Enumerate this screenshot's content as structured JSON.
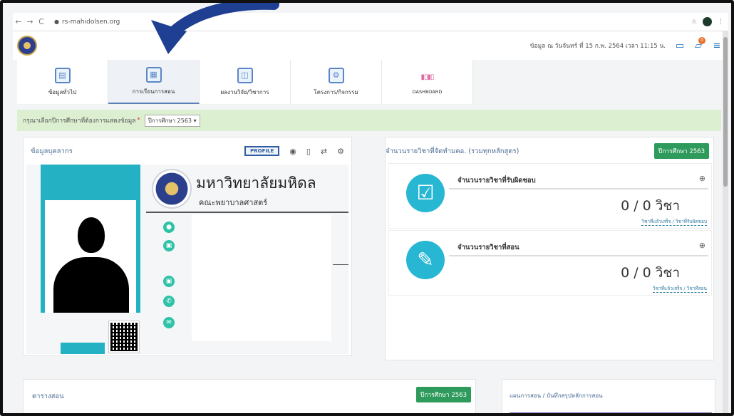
{
  "browser": {
    "url": "rs-mahidolsen.org",
    "nav": {
      "back": "←",
      "forward": "→",
      "reload": "C"
    }
  },
  "header": {
    "info": "ข้อมูล ณ วันจันทร์ ที่ 15 ก.พ. 2564 เวลา 11:15 น.",
    "notification_count": "0"
  },
  "tabs": [
    {
      "label": "ข้อมูลทั่วไป",
      "icon": "id-card-icon"
    },
    {
      "label": "การเรียนการสอน",
      "icon": "teaching-icon"
    },
    {
      "label": "ผลงานวิจัย/วิชาการ",
      "icon": "research-icon"
    },
    {
      "label": "โครงการ/กิจกรรม",
      "icon": "project-icon"
    },
    {
      "label": "DASHBOARD",
      "icon": "dashboard-icon"
    }
  ],
  "year_bar": {
    "label": "กรุณาเลือกปีการศึกษาที่ต้องการแสดงข้อมูล",
    "required": "*",
    "selected": "ปีการศึกษา 2563"
  },
  "profile": {
    "title": "ข้อมูลบุคลากร",
    "profile_button": "PROFILE",
    "university": "มหาวิทยาลัยมหิดล",
    "faculty": "คณะพยาบาลศาสตร์"
  },
  "courses": {
    "title": "จำนวนรายวิชาที่จัดทำมคอ. (รวมทุกหลักสูตร)",
    "year_badge": "ปีการศึกษา 2563",
    "cards": [
      {
        "title": "จำนวนรายวิชาที่รับผิดชอบ",
        "value": "0 / 0 วิชา",
        "link": "วิชาที่แล้วเสร็จ / วิชาที่รับผิดชอบ",
        "icon": "checkbox-icon"
      },
      {
        "title": "จำนวนรายวิชาที่สอน",
        "value": "0 / 0 วิชา",
        "link": "วิชาที่แล้วเสร็จ / วิชาที่สอน",
        "icon": "edit-icon"
      }
    ]
  },
  "schedule": {
    "title": "ตารางสอน",
    "year_badge": "ปีการศึกษา 2563"
  },
  "plan": {
    "title": "แผนการสอน / บันทึกสรุปหลักการสอน"
  },
  "colors": {
    "teal": "#23b1c3",
    "green_badge": "#2e9a5b",
    "year_bar": "#dcefd1",
    "arrow": "#1f3f92"
  }
}
